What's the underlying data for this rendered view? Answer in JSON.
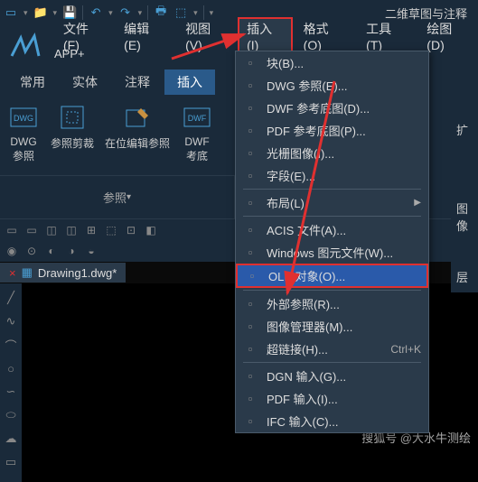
{
  "titlebar": {
    "mode": "二维草图与注释"
  },
  "menubar": {
    "items": [
      "文件(F)",
      "编辑(E)",
      "视图(V)",
      "插入(I)",
      "格式(O)",
      "工具(T)",
      "绘图(D)"
    ],
    "appplus": "APP+"
  },
  "tabs": {
    "items": [
      "常用",
      "实体",
      "注释",
      "插入"
    ],
    "active": 3
  },
  "ribbon": {
    "btns": [
      {
        "label": "DWG\n参照"
      },
      {
        "label": "参照剪裁"
      },
      {
        "label": "在位编辑参照"
      },
      {
        "label": "DWF\n考底"
      }
    ],
    "panel": "参照"
  },
  "side": {
    "items": [
      "扩",
      "图像",
      "层"
    ]
  },
  "doctab": {
    "name": "Drawing1.dwg*"
  },
  "dropdown": {
    "items": [
      {
        "icon": "block",
        "label": "块(B)..."
      },
      {
        "icon": "dwg",
        "label": "DWG 参照(E)..."
      },
      {
        "icon": "dwf",
        "label": "DWF 参考底图(D)..."
      },
      {
        "icon": "pdf",
        "label": "PDF 参考底图(P)..."
      },
      {
        "icon": "img",
        "label": "光栅图像(I)..."
      },
      {
        "icon": "field",
        "label": "字段(E)..."
      },
      {
        "sep": true
      },
      {
        "icon": "layout",
        "label": "布局(L)",
        "sub": true
      },
      {
        "sep": true
      },
      {
        "icon": "acis",
        "label": "ACIS 文件(A)..."
      },
      {
        "icon": "wmf",
        "label": "Windows 图元文件(W)..."
      },
      {
        "icon": "ole",
        "label": "OLE 对象(O)...",
        "hl": true
      },
      {
        "sep": true
      },
      {
        "icon": "xref",
        "label": "外部参照(R)..."
      },
      {
        "icon": "imgmgr",
        "label": "图像管理器(M)..."
      },
      {
        "icon": "link",
        "label": "超链接(H)...",
        "shortcut": "Ctrl+K"
      },
      {
        "sep": true
      },
      {
        "icon": "dgn",
        "label": "DGN 输入(G)..."
      },
      {
        "icon": "pdfin",
        "label": "PDF 输入(I)..."
      },
      {
        "icon": "ifc",
        "label": "IFC 输入(C)..."
      }
    ]
  },
  "watermark": "搜狐号 @大水牛测绘"
}
